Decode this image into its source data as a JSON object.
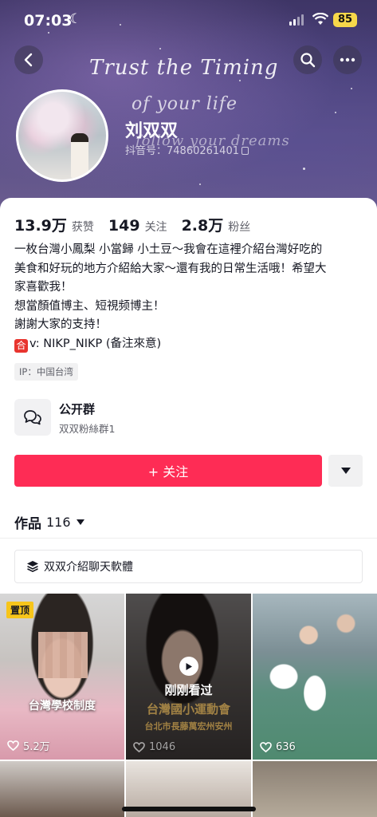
{
  "status_bar": {
    "time": "07:03",
    "battery": "85"
  },
  "banner": {
    "script_line_1": "Trust the Timing",
    "script_line_2": "of your life",
    "script_line_3": "follow your dreams"
  },
  "profile": {
    "name": "刘双双",
    "douyin_id": "抖音号：74860261401"
  },
  "stats": [
    {
      "value": "13.9万",
      "label": "获赞"
    },
    {
      "value": "149",
      "label": "关注"
    },
    {
      "value": "2.8万",
      "label": "粉丝"
    }
  ],
  "bio": {
    "line1": "一枚台灣小鳳梨  小當歸  小土豆～我會在這裡介紹台灣好吃的",
    "line2": "美食和好玩的地方介紹給大家～還有我的日常生活哦！希望大",
    "line3": "家喜歡我！",
    "line4": "想當顏值博主、短視频博主！",
    "line5": "謝謝大家的支持！",
    "line6_badge": "合",
    "line6": "v: NIKP_NIKP (备注來意)"
  },
  "ip": "IP：中国台湾",
  "group": {
    "title": "公开群",
    "subtitle": "双双粉絲群1"
  },
  "follow_button": "+ 关注",
  "works_tab": {
    "label": "作品",
    "count": "116"
  },
  "collection": {
    "label": "双双介紹聊天軟體"
  },
  "videos": [
    {
      "pinned": "置顶",
      "caption": "台灣學校制度",
      "likes": "5.2万"
    },
    {
      "watched": "刚刚看过",
      "caption": "台灣國小運動會",
      "subcaption": "台北市長藤萬宏州安州",
      "likes": "1046"
    },
    {
      "likes": "636"
    }
  ],
  "icons": {
    "back": "chevron-left-icon",
    "search": "search-icon",
    "more": "more-icon",
    "group": "chat-bubbles-icon",
    "collection": "layers-icon",
    "heart": "heart-icon",
    "play": "play-icon"
  },
  "colors": {
    "accent": "#fe2c55",
    "pinned": "#f7c51a",
    "battery": "#f7d84a"
  }
}
